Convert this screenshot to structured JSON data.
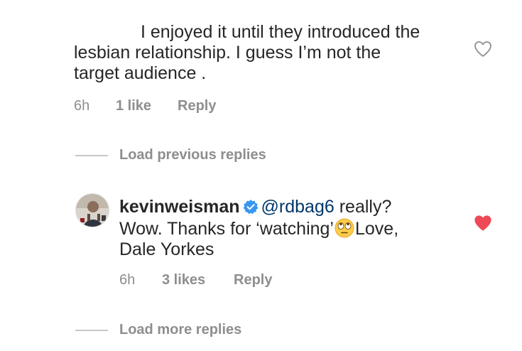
{
  "comment1": {
    "text_line1": "I enjoyed it until they introduced the",
    "text_line2": "lesbian relationship. I guess I’m not the",
    "text_line3": "target audience .",
    "time": "6h",
    "likes": "1 like",
    "reply": "Reply",
    "heart_icon": "heart-outline-icon",
    "liked": false
  },
  "load_previous": "Load previous replies",
  "comment2": {
    "username": "kevinweisman",
    "verified_icon": "verified-badge-icon",
    "mention": "@rdbag6",
    "text_part1": " really?",
    "text_part2": "Wow. Thanks for ‘watching’",
    "emoji_icon": "eye-roll-emoji-icon",
    "text_part3": "Love,",
    "text_part4": "Dale Yorkes",
    "time": "6h",
    "likes": "3 likes",
    "reply": "Reply",
    "heart_icon": "heart-filled-icon",
    "liked": true
  },
  "load_more": "Load more replies",
  "colors": {
    "text": "#262626",
    "secondary": "#8e8e8e",
    "heart_red": "#ed4956",
    "verified_blue": "#3897f0",
    "mention": "#00376b"
  }
}
